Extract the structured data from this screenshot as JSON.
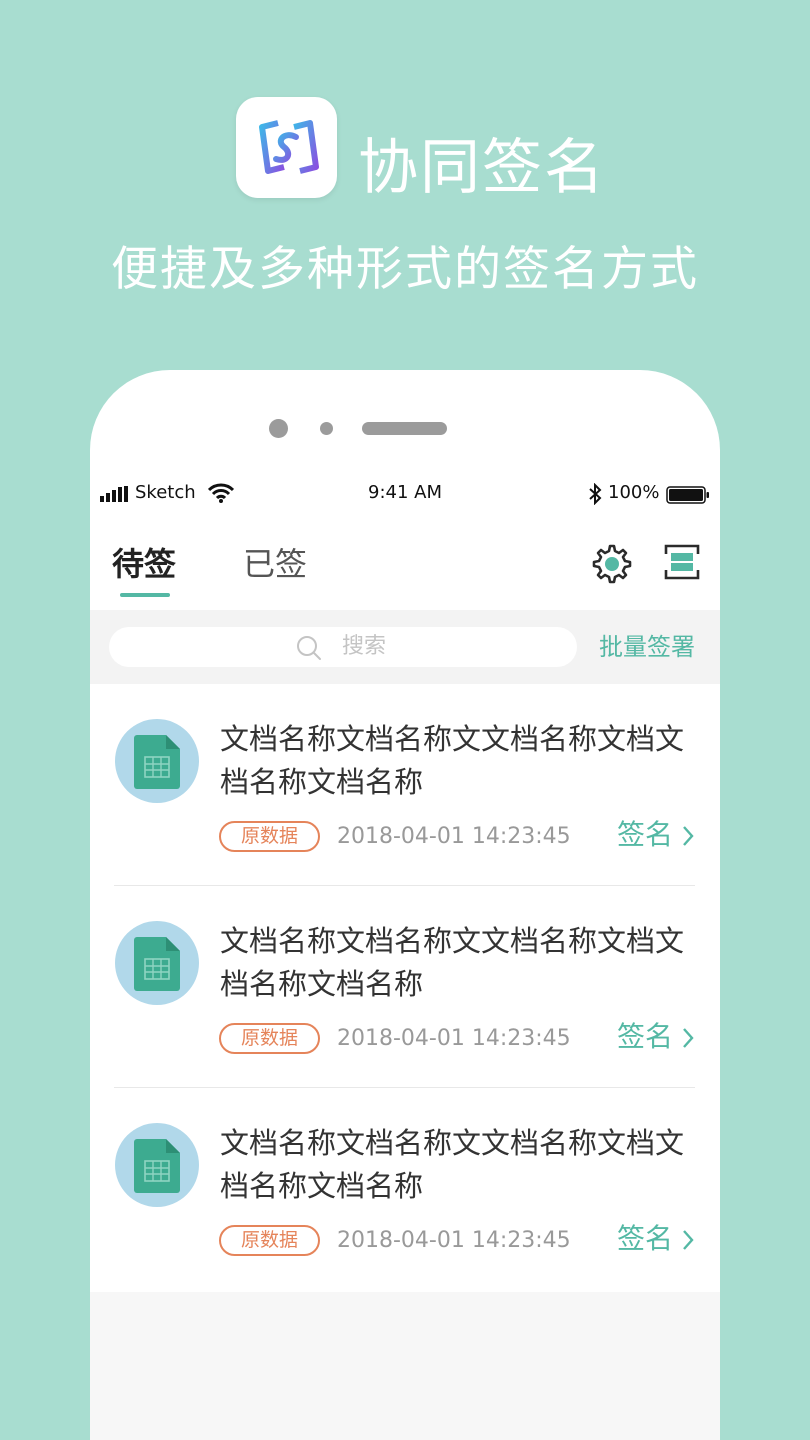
{
  "promo": {
    "app_name": "协同签名",
    "tagline": "便捷及多种形式的签名方式",
    "icon_name": "app-logo-icon",
    "background_color": "#a8ddd0"
  },
  "status_bar": {
    "carrier": "Sketch",
    "time": "9:41 AM",
    "battery_percent": "100%",
    "icons": [
      "signal-icon",
      "wifi-icon",
      "bluetooth-icon",
      "battery-icon"
    ]
  },
  "header": {
    "tabs": [
      {
        "label": "待签",
        "active": true
      },
      {
        "label": "已签",
        "active": false
      }
    ],
    "icons": [
      "gear-icon",
      "scan-icon"
    ],
    "accent_color": "#54b8a4"
  },
  "search": {
    "placeholder": "搜索",
    "batch_sign_label": "批量签署"
  },
  "documents": [
    {
      "title": "文档名称文档名称文文档名称文档文档名称文档名称",
      "tag": "原数据",
      "timestamp": "2018-04-01 14:23:45",
      "action_label": "签名"
    },
    {
      "title": "文档名称文档名称文文档名称文档文档名称文档名称",
      "tag": "原数据",
      "timestamp": "2018-04-01 14:23:45",
      "action_label": "签名"
    },
    {
      "title": "文档名称文档名称文文档名称文档文档名称文档名称",
      "tag": "原数据",
      "timestamp": "2018-04-01 14:23:45",
      "action_label": "签名"
    }
  ],
  "colors": {
    "tag": "#e5845a",
    "document_icon_bg": "#b1d8ea",
    "document_icon": "#3dab90"
  }
}
